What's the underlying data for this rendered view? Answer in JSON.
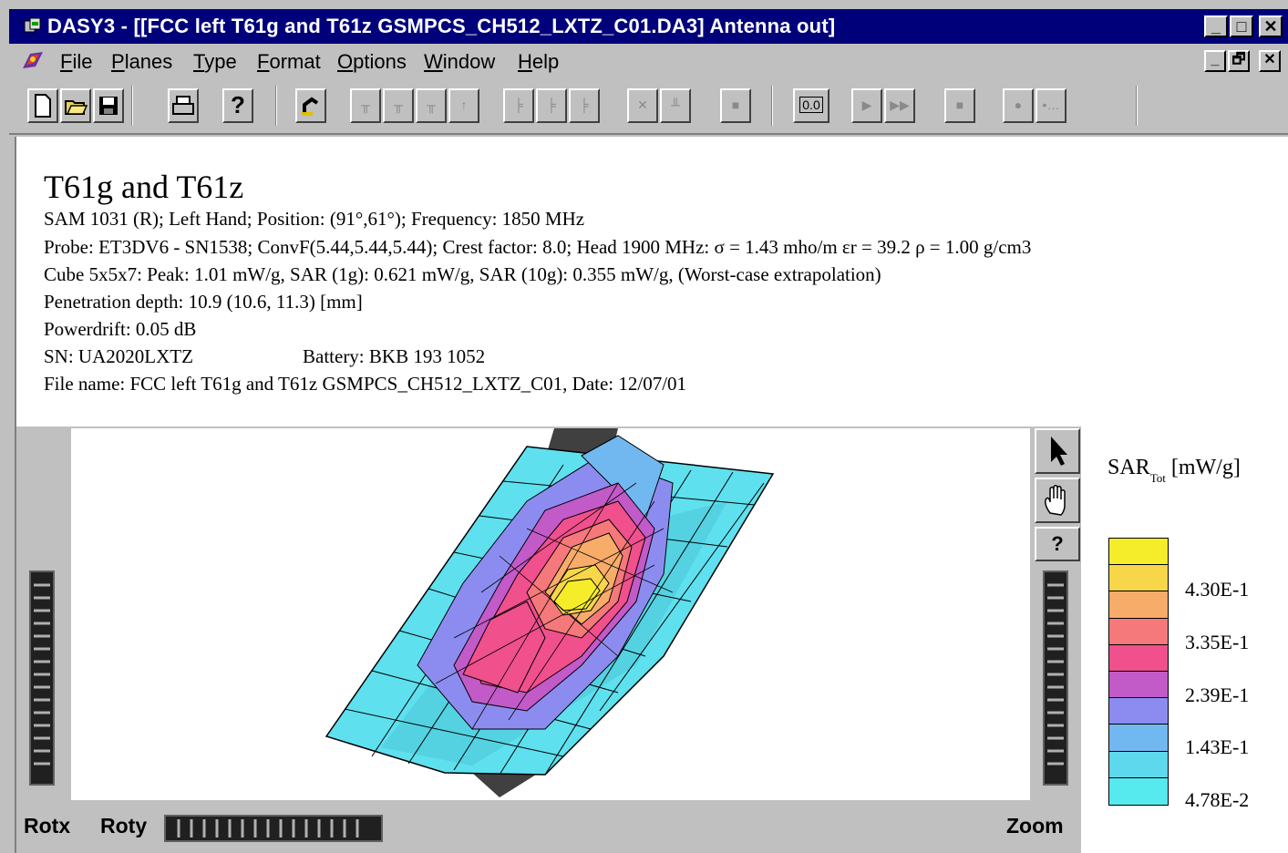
{
  "window": {
    "title": "DASY3 - [[FCC left T61g and T61z  GSMPCS_CH512_LXTZ_C01.DA3]  Antenna out]",
    "caption_buttons": [
      "_",
      "□",
      "✕"
    ]
  },
  "menu": {
    "items": [
      "File",
      "Planes",
      "Type",
      "Format",
      "Options",
      "Window",
      "Help"
    ],
    "mdi_buttons": [
      "_",
      "🗗",
      "✕"
    ]
  },
  "toolbar": {
    "counter_label": "0.0"
  },
  "document": {
    "title": "T61g and T61z",
    "lines": {
      "setup": "SAM 1031 (R); Left Hand; Position: (91°,61°); Frequency: 1850 MHz",
      "probe": "Probe: ET3DV6 - SN1538; ConvF(5.44,5.44,5.44); Crest factor: 8.0; Head 1900 MHz: σ = 1.43 mho/m εr = 39.2 ρ = 1.00 g/cm3",
      "cube": "Cube 5x5x7: Peak: 1.01   mW/g, SAR (1g): 0.621  mW/g, SAR (10g): 0.355  mW/g, (Worst-case extrapolation)",
      "penetration": "Penetration depth: 10.9 (10.6, 11.3) [mm]",
      "powerdrift": "Powerdrift: 0.05 dB",
      "sn": "SN: UA2020LXTZ",
      "battery": "Battery: BKB 193 1052",
      "filename": "File name: FCC left T61g and T61z  GSMPCS_CH512_LXTZ_C01, Date: 12/07/01"
    }
  },
  "controls": {
    "rotx": "Rotx",
    "roty": "Roty",
    "zoom": "Zoom"
  },
  "legend": {
    "title_main": "SAR",
    "title_sub": "Tot",
    "title_unit": "[mW/g]",
    "colors": [
      "#f5ec2a",
      "#f8d64a",
      "#f8ac6a",
      "#f5787a",
      "#f0508c",
      "#c25ac8",
      "#8c8cf0",
      "#72b8f0",
      "#5ed8ec",
      "#56eaee"
    ],
    "labels": [
      "4.30E-1",
      "3.35E-1",
      "2.39E-1",
      "1.43E-1",
      "4.78E-2"
    ]
  },
  "icons": {
    "app": "dasy-app-icon",
    "doc": "dasy-doc-icon",
    "pointer": "arrow-pointer-icon",
    "hand": "hand-pan-icon",
    "help": "help-question-icon"
  }
}
